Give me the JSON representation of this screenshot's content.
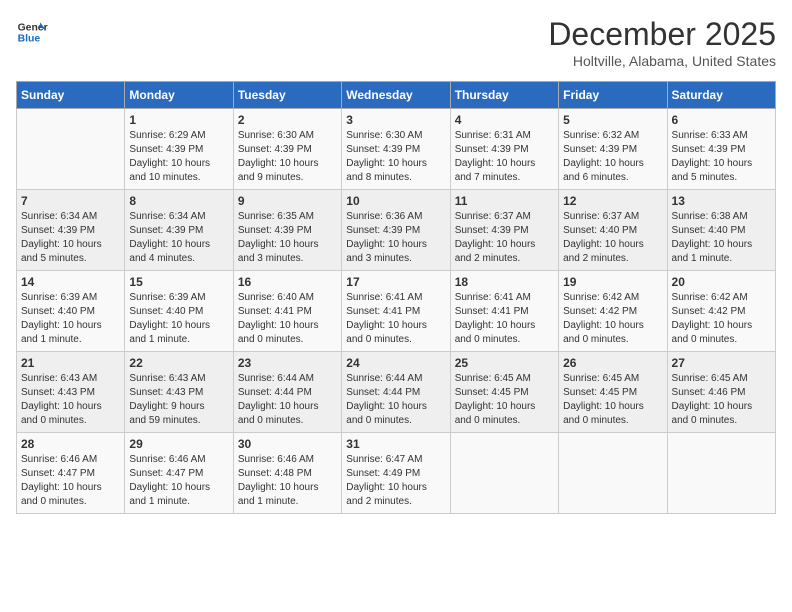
{
  "header": {
    "logo_line1": "General",
    "logo_line2": "Blue",
    "main_title": "December 2025",
    "subtitle": "Holtville, Alabama, United States"
  },
  "weekdays": [
    "Sunday",
    "Monday",
    "Tuesday",
    "Wednesday",
    "Thursday",
    "Friday",
    "Saturday"
  ],
  "weeks": [
    [
      {
        "day": "",
        "info": ""
      },
      {
        "day": "1",
        "info": "Sunrise: 6:29 AM\nSunset: 4:39 PM\nDaylight: 10 hours\nand 10 minutes."
      },
      {
        "day": "2",
        "info": "Sunrise: 6:30 AM\nSunset: 4:39 PM\nDaylight: 10 hours\nand 9 minutes."
      },
      {
        "day": "3",
        "info": "Sunrise: 6:30 AM\nSunset: 4:39 PM\nDaylight: 10 hours\nand 8 minutes."
      },
      {
        "day": "4",
        "info": "Sunrise: 6:31 AM\nSunset: 4:39 PM\nDaylight: 10 hours\nand 7 minutes."
      },
      {
        "day": "5",
        "info": "Sunrise: 6:32 AM\nSunset: 4:39 PM\nDaylight: 10 hours\nand 6 minutes."
      },
      {
        "day": "6",
        "info": "Sunrise: 6:33 AM\nSunset: 4:39 PM\nDaylight: 10 hours\nand 5 minutes."
      }
    ],
    [
      {
        "day": "7",
        "info": "Sunrise: 6:34 AM\nSunset: 4:39 PM\nDaylight: 10 hours\nand 5 minutes."
      },
      {
        "day": "8",
        "info": "Sunrise: 6:34 AM\nSunset: 4:39 PM\nDaylight: 10 hours\nand 4 minutes."
      },
      {
        "day": "9",
        "info": "Sunrise: 6:35 AM\nSunset: 4:39 PM\nDaylight: 10 hours\nand 3 minutes."
      },
      {
        "day": "10",
        "info": "Sunrise: 6:36 AM\nSunset: 4:39 PM\nDaylight: 10 hours\nand 3 minutes."
      },
      {
        "day": "11",
        "info": "Sunrise: 6:37 AM\nSunset: 4:39 PM\nDaylight: 10 hours\nand 2 minutes."
      },
      {
        "day": "12",
        "info": "Sunrise: 6:37 AM\nSunset: 4:40 PM\nDaylight: 10 hours\nand 2 minutes."
      },
      {
        "day": "13",
        "info": "Sunrise: 6:38 AM\nSunset: 4:40 PM\nDaylight: 10 hours\nand 1 minute."
      }
    ],
    [
      {
        "day": "14",
        "info": "Sunrise: 6:39 AM\nSunset: 4:40 PM\nDaylight: 10 hours\nand 1 minute."
      },
      {
        "day": "15",
        "info": "Sunrise: 6:39 AM\nSunset: 4:40 PM\nDaylight: 10 hours\nand 1 minute."
      },
      {
        "day": "16",
        "info": "Sunrise: 6:40 AM\nSunset: 4:41 PM\nDaylight: 10 hours\nand 0 minutes."
      },
      {
        "day": "17",
        "info": "Sunrise: 6:41 AM\nSunset: 4:41 PM\nDaylight: 10 hours\nand 0 minutes."
      },
      {
        "day": "18",
        "info": "Sunrise: 6:41 AM\nSunset: 4:41 PM\nDaylight: 10 hours\nand 0 minutes."
      },
      {
        "day": "19",
        "info": "Sunrise: 6:42 AM\nSunset: 4:42 PM\nDaylight: 10 hours\nand 0 minutes."
      },
      {
        "day": "20",
        "info": "Sunrise: 6:42 AM\nSunset: 4:42 PM\nDaylight: 10 hours\nand 0 minutes."
      }
    ],
    [
      {
        "day": "21",
        "info": "Sunrise: 6:43 AM\nSunset: 4:43 PM\nDaylight: 10 hours\nand 0 minutes."
      },
      {
        "day": "22",
        "info": "Sunrise: 6:43 AM\nSunset: 4:43 PM\nDaylight: 9 hours\nand 59 minutes."
      },
      {
        "day": "23",
        "info": "Sunrise: 6:44 AM\nSunset: 4:44 PM\nDaylight: 10 hours\nand 0 minutes."
      },
      {
        "day": "24",
        "info": "Sunrise: 6:44 AM\nSunset: 4:44 PM\nDaylight: 10 hours\nand 0 minutes."
      },
      {
        "day": "25",
        "info": "Sunrise: 6:45 AM\nSunset: 4:45 PM\nDaylight: 10 hours\nand 0 minutes."
      },
      {
        "day": "26",
        "info": "Sunrise: 6:45 AM\nSunset: 4:45 PM\nDaylight: 10 hours\nand 0 minutes."
      },
      {
        "day": "27",
        "info": "Sunrise: 6:45 AM\nSunset: 4:46 PM\nDaylight: 10 hours\nand 0 minutes."
      }
    ],
    [
      {
        "day": "28",
        "info": "Sunrise: 6:46 AM\nSunset: 4:47 PM\nDaylight: 10 hours\nand 0 minutes."
      },
      {
        "day": "29",
        "info": "Sunrise: 6:46 AM\nSunset: 4:47 PM\nDaylight: 10 hours\nand 1 minute."
      },
      {
        "day": "30",
        "info": "Sunrise: 6:46 AM\nSunset: 4:48 PM\nDaylight: 10 hours\nand 1 minute."
      },
      {
        "day": "31",
        "info": "Sunrise: 6:47 AM\nSunset: 4:49 PM\nDaylight: 10 hours\nand 2 minutes."
      },
      {
        "day": "",
        "info": ""
      },
      {
        "day": "",
        "info": ""
      },
      {
        "day": "",
        "info": ""
      }
    ]
  ]
}
